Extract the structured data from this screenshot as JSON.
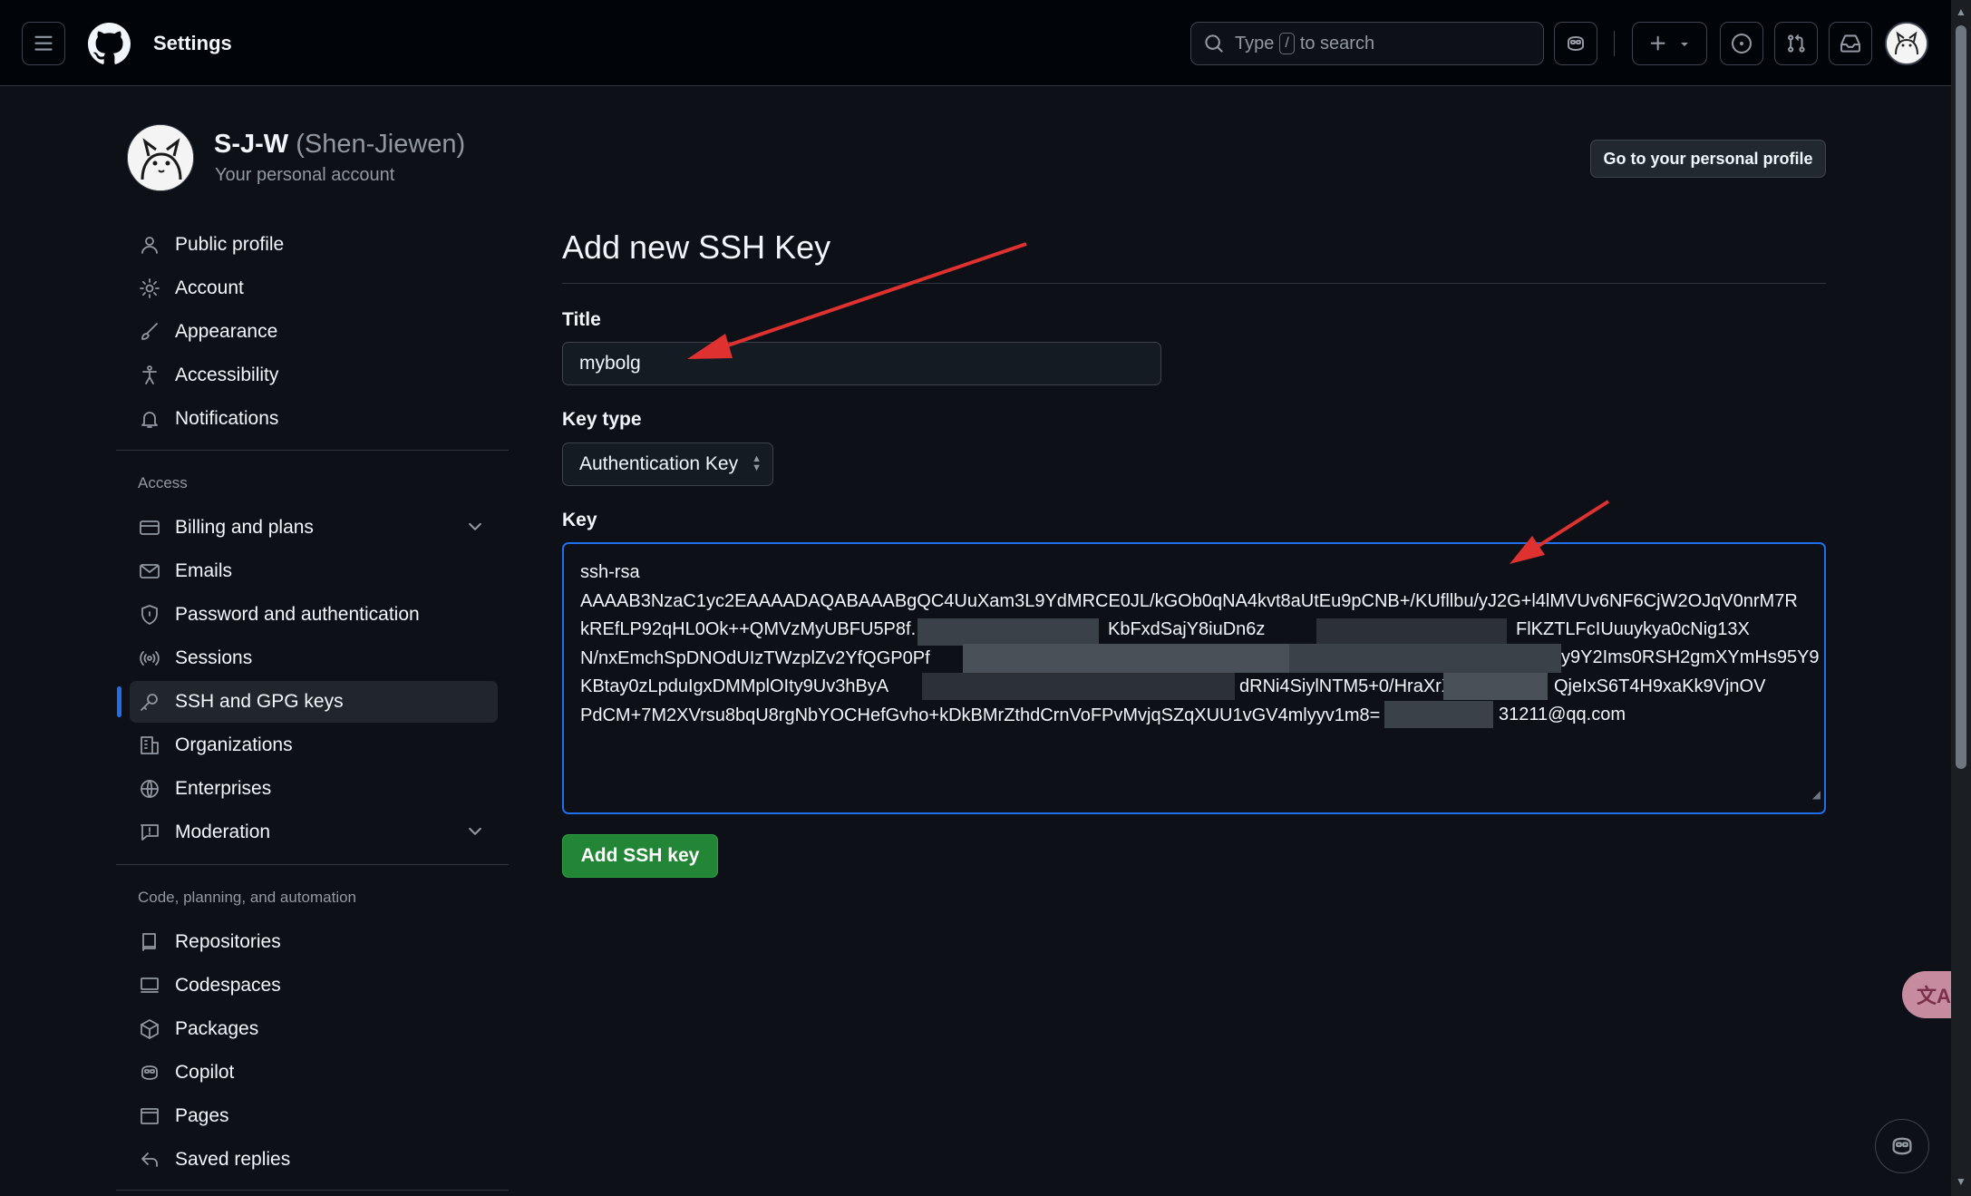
{
  "header": {
    "title": "Settings",
    "search": {
      "before": "Type",
      "key": "/",
      "after": "to search"
    }
  },
  "account": {
    "username": "S-J-W",
    "full_name": "(Shen-Jiewen)",
    "subtitle": "Your personal account",
    "profile_button": "Go to your personal profile"
  },
  "sidebar": {
    "items": [
      {
        "label": "Public profile",
        "icon": "person-icon"
      },
      {
        "label": "Account",
        "icon": "gear-icon"
      },
      {
        "label": "Appearance",
        "icon": "paintbrush-icon"
      },
      {
        "label": "Accessibility",
        "icon": "accessibility-icon"
      },
      {
        "label": "Notifications",
        "icon": "bell-icon"
      }
    ],
    "access_heading": "Access",
    "access_items": [
      {
        "label": "Billing and plans",
        "icon": "credit-card-icon",
        "expandable": true
      },
      {
        "label": "Emails",
        "icon": "mail-icon"
      },
      {
        "label": "Password and authentication",
        "icon": "shield-icon"
      },
      {
        "label": "Sessions",
        "icon": "broadcast-icon"
      },
      {
        "label": "SSH and GPG keys",
        "icon": "key-icon",
        "active": true
      },
      {
        "label": "Organizations",
        "icon": "organization-icon"
      },
      {
        "label": "Enterprises",
        "icon": "globe-icon"
      },
      {
        "label": "Moderation",
        "icon": "report-icon",
        "expandable": true
      }
    ],
    "code_heading": "Code, planning, and automation",
    "code_items": [
      {
        "label": "Repositories",
        "icon": "repo-icon"
      },
      {
        "label": "Codespaces",
        "icon": "codespaces-icon"
      },
      {
        "label": "Packages",
        "icon": "package-icon"
      },
      {
        "label": "Copilot",
        "icon": "copilot-icon"
      },
      {
        "label": "Pages",
        "icon": "browser-icon"
      },
      {
        "label": "Saved replies",
        "icon": "reply-icon"
      }
    ]
  },
  "form": {
    "heading": "Add new SSH Key",
    "title_label": "Title",
    "title_value": "mybolg",
    "keytype_label": "Key type",
    "keytype_value": "Authentication Key",
    "key_label": "Key",
    "key_lines": [
      "ssh-rsa",
      "AAAAB3NzaC1yc2EAAAADAQABAAABgQC4UuXam3L9YdMRCE0JL/kGOb0qNA4kvt8aUtEu9pCNB+/KUfllbu/yJ2G+l4lMVUv6NF6CjW2OJqV0nrM7R",
      "kREfLP92qHL0Ok++QMVzMyUBFU5P8f.",
      "N/nxEmchSpDNOdUIzTWzplZv2YfQGP0Pf",
      "KBtay0zLpduIgxDMMplOIty9Uv3hByA",
      "PdCM+7M2XVrsu8bqU8rgNbYOCHefGvho+kDkBMrZthdCrnVoFPvMvjqSZqXUU1vGV4mlyyv1m8="
    ],
    "key_tail_2": "KbFxdSajY8iuDn6z",
    "key_tail_2b": "FlKZTLFcIUuuykya0cNig13X",
    "key_tail_3": "y9Y2Ims0RSH2gmXYmHs95Y9",
    "key_tail_4": "dRNi4SiylNTM5+0/HraXrXyIoST",
    "key_tail_4b": "QjeIxS6T4H9xaKk9VjnOV",
    "key_tail_5": "31211@qq.com",
    "submit": "Add SSH key"
  },
  "floating": {
    "translate": "文A"
  },
  "colors": {
    "accent": "#1f6feb",
    "primary_button": "#238636",
    "annotation_arrow": "#e03131"
  }
}
